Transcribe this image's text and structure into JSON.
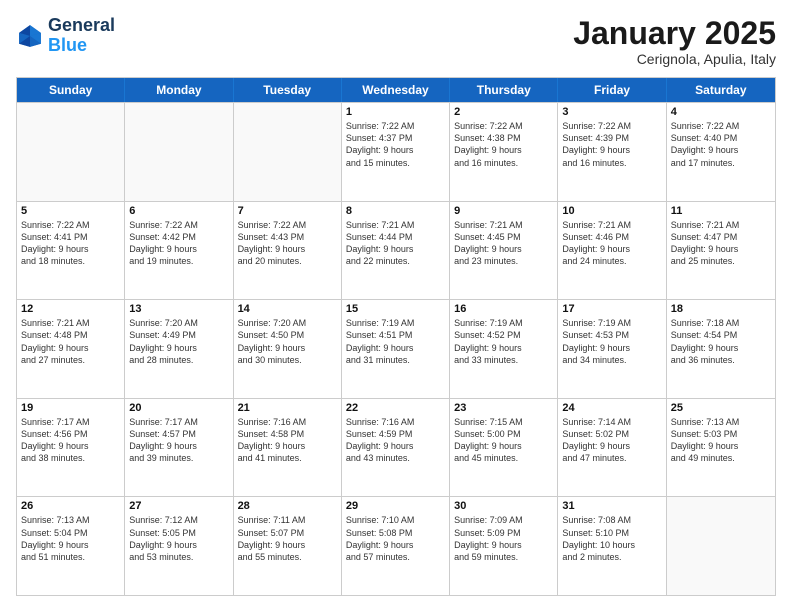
{
  "logo": {
    "line1": "General",
    "line2": "Blue"
  },
  "title": "January 2025",
  "subtitle": "Cerignola, Apulia, Italy",
  "weekdays": [
    "Sunday",
    "Monday",
    "Tuesday",
    "Wednesday",
    "Thursday",
    "Friday",
    "Saturday"
  ],
  "weeks": [
    [
      {
        "day": "",
        "info": ""
      },
      {
        "day": "",
        "info": ""
      },
      {
        "day": "",
        "info": ""
      },
      {
        "day": "1",
        "info": "Sunrise: 7:22 AM\nSunset: 4:37 PM\nDaylight: 9 hours\nand 15 minutes."
      },
      {
        "day": "2",
        "info": "Sunrise: 7:22 AM\nSunset: 4:38 PM\nDaylight: 9 hours\nand 16 minutes."
      },
      {
        "day": "3",
        "info": "Sunrise: 7:22 AM\nSunset: 4:39 PM\nDaylight: 9 hours\nand 16 minutes."
      },
      {
        "day": "4",
        "info": "Sunrise: 7:22 AM\nSunset: 4:40 PM\nDaylight: 9 hours\nand 17 minutes."
      }
    ],
    [
      {
        "day": "5",
        "info": "Sunrise: 7:22 AM\nSunset: 4:41 PM\nDaylight: 9 hours\nand 18 minutes."
      },
      {
        "day": "6",
        "info": "Sunrise: 7:22 AM\nSunset: 4:42 PM\nDaylight: 9 hours\nand 19 minutes."
      },
      {
        "day": "7",
        "info": "Sunrise: 7:22 AM\nSunset: 4:43 PM\nDaylight: 9 hours\nand 20 minutes."
      },
      {
        "day": "8",
        "info": "Sunrise: 7:21 AM\nSunset: 4:44 PM\nDaylight: 9 hours\nand 22 minutes."
      },
      {
        "day": "9",
        "info": "Sunrise: 7:21 AM\nSunset: 4:45 PM\nDaylight: 9 hours\nand 23 minutes."
      },
      {
        "day": "10",
        "info": "Sunrise: 7:21 AM\nSunset: 4:46 PM\nDaylight: 9 hours\nand 24 minutes."
      },
      {
        "day": "11",
        "info": "Sunrise: 7:21 AM\nSunset: 4:47 PM\nDaylight: 9 hours\nand 25 minutes."
      }
    ],
    [
      {
        "day": "12",
        "info": "Sunrise: 7:21 AM\nSunset: 4:48 PM\nDaylight: 9 hours\nand 27 minutes."
      },
      {
        "day": "13",
        "info": "Sunrise: 7:20 AM\nSunset: 4:49 PM\nDaylight: 9 hours\nand 28 minutes."
      },
      {
        "day": "14",
        "info": "Sunrise: 7:20 AM\nSunset: 4:50 PM\nDaylight: 9 hours\nand 30 minutes."
      },
      {
        "day": "15",
        "info": "Sunrise: 7:19 AM\nSunset: 4:51 PM\nDaylight: 9 hours\nand 31 minutes."
      },
      {
        "day": "16",
        "info": "Sunrise: 7:19 AM\nSunset: 4:52 PM\nDaylight: 9 hours\nand 33 minutes."
      },
      {
        "day": "17",
        "info": "Sunrise: 7:19 AM\nSunset: 4:53 PM\nDaylight: 9 hours\nand 34 minutes."
      },
      {
        "day": "18",
        "info": "Sunrise: 7:18 AM\nSunset: 4:54 PM\nDaylight: 9 hours\nand 36 minutes."
      }
    ],
    [
      {
        "day": "19",
        "info": "Sunrise: 7:17 AM\nSunset: 4:56 PM\nDaylight: 9 hours\nand 38 minutes."
      },
      {
        "day": "20",
        "info": "Sunrise: 7:17 AM\nSunset: 4:57 PM\nDaylight: 9 hours\nand 39 minutes."
      },
      {
        "day": "21",
        "info": "Sunrise: 7:16 AM\nSunset: 4:58 PM\nDaylight: 9 hours\nand 41 minutes."
      },
      {
        "day": "22",
        "info": "Sunrise: 7:16 AM\nSunset: 4:59 PM\nDaylight: 9 hours\nand 43 minutes."
      },
      {
        "day": "23",
        "info": "Sunrise: 7:15 AM\nSunset: 5:00 PM\nDaylight: 9 hours\nand 45 minutes."
      },
      {
        "day": "24",
        "info": "Sunrise: 7:14 AM\nSunset: 5:02 PM\nDaylight: 9 hours\nand 47 minutes."
      },
      {
        "day": "25",
        "info": "Sunrise: 7:13 AM\nSunset: 5:03 PM\nDaylight: 9 hours\nand 49 minutes."
      }
    ],
    [
      {
        "day": "26",
        "info": "Sunrise: 7:13 AM\nSunset: 5:04 PM\nDaylight: 9 hours\nand 51 minutes."
      },
      {
        "day": "27",
        "info": "Sunrise: 7:12 AM\nSunset: 5:05 PM\nDaylight: 9 hours\nand 53 minutes."
      },
      {
        "day": "28",
        "info": "Sunrise: 7:11 AM\nSunset: 5:07 PM\nDaylight: 9 hours\nand 55 minutes."
      },
      {
        "day": "29",
        "info": "Sunrise: 7:10 AM\nSunset: 5:08 PM\nDaylight: 9 hours\nand 57 minutes."
      },
      {
        "day": "30",
        "info": "Sunrise: 7:09 AM\nSunset: 5:09 PM\nDaylight: 9 hours\nand 59 minutes."
      },
      {
        "day": "31",
        "info": "Sunrise: 7:08 AM\nSunset: 5:10 PM\nDaylight: 10 hours\nand 2 minutes."
      },
      {
        "day": "",
        "info": ""
      }
    ]
  ]
}
